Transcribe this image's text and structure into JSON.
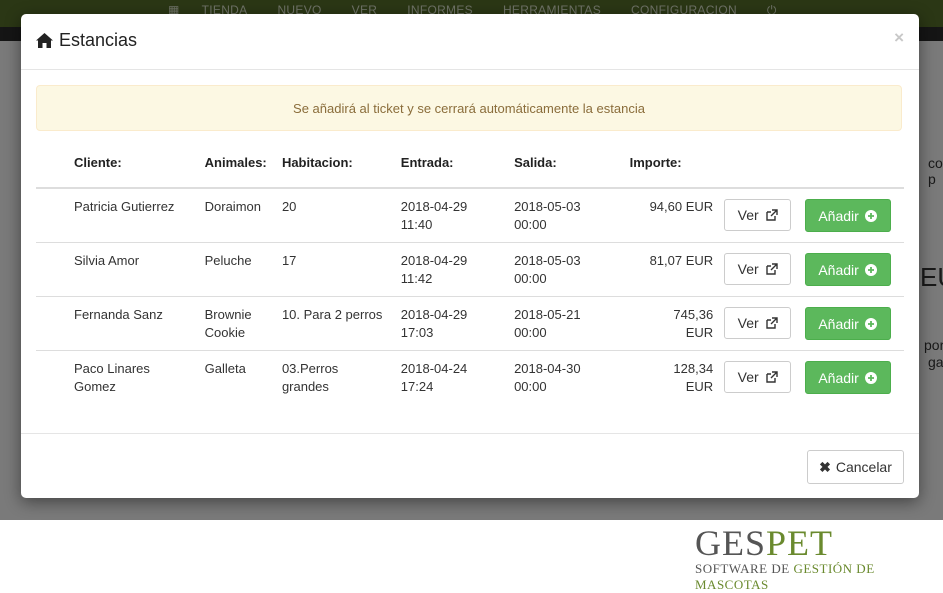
{
  "topnav": [
    "TIENDA",
    "NUEVO",
    "VER",
    "INFORMES",
    "HERRAMIENTAS",
    "CONFIGURACION"
  ],
  "background_fragments": [
    "co p",
    "EU",
    "port",
    "gat"
  ],
  "modal": {
    "title": "Estancias",
    "close": "×",
    "alert": "Se añadirá al ticket y se cerrará automáticamente la estancia",
    "columns": [
      "Cliente:",
      "Animales:",
      "Habitacion:",
      "Entrada:",
      "Salida:",
      "Importe:"
    ],
    "rows": [
      {
        "cliente": [
          "Patricia Gutierrez"
        ],
        "animales": [
          "Doraimon"
        ],
        "habitacion": [
          "20"
        ],
        "entrada": [
          "2018-04-29",
          "11:40"
        ],
        "salida": [
          "2018-05-03",
          "00:00"
        ],
        "importe": [
          "94,60 EUR"
        ]
      },
      {
        "cliente": [
          "Silvia Amor"
        ],
        "animales": [
          "Peluche"
        ],
        "habitacion": [
          "17"
        ],
        "entrada": [
          "2018-04-29",
          "11:42"
        ],
        "salida": [
          "2018-05-03",
          "00:00"
        ],
        "importe": [
          "81,07 EUR"
        ]
      },
      {
        "cliente": [
          "Fernanda Sanz"
        ],
        "animales": [
          "Brownie",
          "Cookie"
        ],
        "habitacion": [
          "10. Para 2 perros"
        ],
        "entrada": [
          "2018-04-29",
          "17:03"
        ],
        "salida": [
          "2018-05-21",
          "00:00"
        ],
        "importe": [
          "745,36",
          "EUR"
        ]
      },
      {
        "cliente": [
          "Paco Linares",
          "Gomez"
        ],
        "animales": [
          "Galleta"
        ],
        "habitacion": [
          "03.Perros",
          "grandes"
        ],
        "entrada": [
          "2018-04-24",
          "17:24"
        ],
        "salida": [
          "2018-04-30",
          "00:00"
        ],
        "importe": [
          "128,34",
          "EUR"
        ]
      }
    ],
    "ver_label": "Ver",
    "add_label": "Añadir",
    "cancel_label": "Cancelar"
  },
  "logo": {
    "name_part1": "GES",
    "name_part2": "PET",
    "sub_part1": "SOFTWARE DE ",
    "sub_part2": "GESTIÓN DE MASCOTAS"
  },
  "colors": {
    "accent_green": "#5cb85c",
    "topbar": "#566f2a",
    "alert_bg": "#fcf8e3",
    "alert_text": "#8a6d3b"
  }
}
